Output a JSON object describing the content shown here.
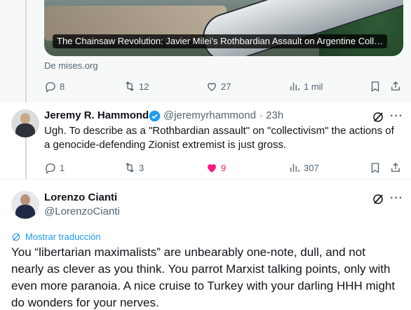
{
  "top_tweet": {
    "card_title": "The Chainsaw Revolution: Javier Milei’s Rothbardian Assault on Argentine Coll…",
    "source": "De mises.org",
    "actions": {
      "replies": "8",
      "retweets": "12",
      "likes": "27",
      "views": "1 mil"
    }
  },
  "reply_tweet": {
    "name": "Jeremy R. Hammond",
    "handle": "@jeremyrhammond",
    "time": "· 23h",
    "text_line1": "Ugh. To describe as a \"Rothbardian assault\" on \"collectivism\" the actions of",
    "text_line2": "a genocide-defending Zionist extremist is just gross.",
    "actions": {
      "replies": "1",
      "retweets": "3",
      "likes": "9",
      "views": "307"
    },
    "liked_color": "#f91880"
  },
  "main_tweet": {
    "name": "Lorenzo Cianti",
    "handle": "@LorenzoCianti",
    "translate_label": "Mostrar traducción",
    "text_line1": "You “libertarian maximalists” are unbearably one-note, dull, and not",
    "text_line2": "nearly as clever as you think. You parrot Marxist talking points, only with",
    "text_line3": "even more paranoia. A nice cruise to Turkey with your darling HHH might",
    "text_line4": "do wonders for your nerves."
  },
  "icons": [
    "reply-icon",
    "retweet-icon",
    "like-icon",
    "views-icon",
    "bookmark-icon",
    "share-icon",
    "verified-icon",
    "grok-icon",
    "more-icon",
    "translate-icon"
  ],
  "colors": {
    "accent": "#1d9bf0",
    "muted": "#536471",
    "text": "#0f1419",
    "like": "#f91880"
  }
}
